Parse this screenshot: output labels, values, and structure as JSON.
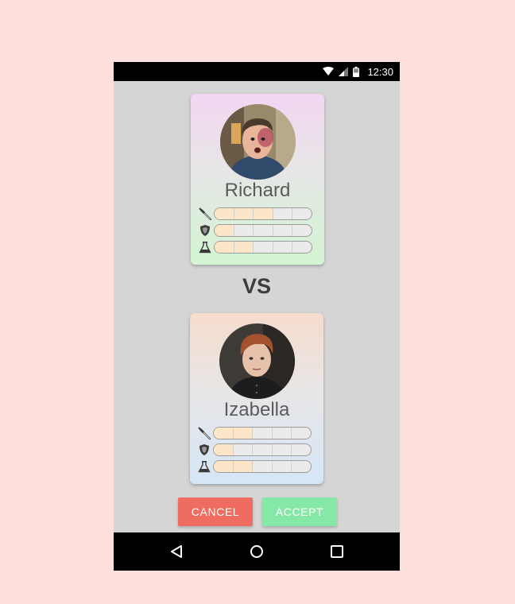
{
  "status_bar": {
    "time": "12:30"
  },
  "fighters": [
    {
      "name": "Richard",
      "stats": {
        "attack": 0.6,
        "defense": 0.2,
        "magic": 0.4
      }
    },
    {
      "name": "Izabella",
      "stats": {
        "attack": 0.4,
        "defense": 0.2,
        "magic": 0.4
      }
    }
  ],
  "versus_label": "VS",
  "buttons": {
    "cancel": "CANCEL",
    "accept": "ACCEPT"
  },
  "colors": {
    "background": "#fde0db",
    "cancel": "#ef6c60",
    "accept": "#86e8a7",
    "stat_fill": "#fde6c7"
  },
  "icons": {
    "attack": "sword-icon",
    "defense": "shield-icon",
    "magic": "potion-flask-icon"
  }
}
